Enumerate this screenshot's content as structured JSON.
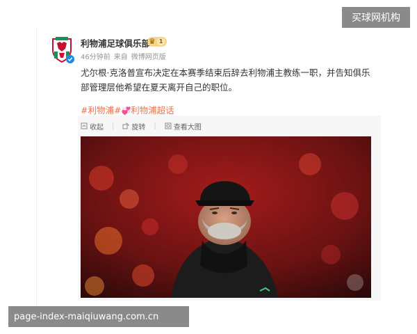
{
  "watermark_top": "买球网机构",
  "watermark_bottom": "page-index-maiqiuwang.com.cn",
  "post": {
    "account_name": "利物浦足球俱乐部",
    "level": "1",
    "time": "46分钟前",
    "source_prefix": "来自",
    "source": "微博网页版",
    "text": "尤尔根·克洛普宣布决定在本赛季结束后辞去利物浦主教练一职，并告知俱乐部管理层他希望在夏天离开自己的职位。",
    "tag1": "#利物浦#",
    "tag2": "利物浦超话"
  },
  "toolbar": {
    "collapse": "收起",
    "rotate": "旋转",
    "view_large": "查看大图"
  },
  "colors": {
    "tag": "#eb7350",
    "verified": "#1e88e5",
    "club_red": "#c8102e"
  }
}
